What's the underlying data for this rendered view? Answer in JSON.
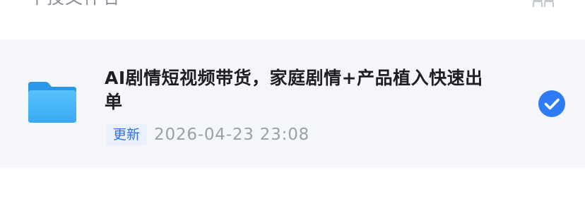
{
  "header": {
    "title": "千技文件名",
    "grid_icon": "grid-view-icon"
  },
  "file_item": {
    "icon": "folder-icon",
    "name": "AI剧情短视频带货，家庭剧情+产品植入快速出单",
    "badge_label": "更新",
    "updated_at": "2026-04-23 23:08",
    "selected": true,
    "check_icon": "check-circle-icon"
  },
  "colors": {
    "item_background": "#f5f6fa",
    "accent": "#2f7bf5",
    "folder": "#3fb2f5",
    "badge_text": "#2f6fe4",
    "badge_background": "#eaf1fd"
  }
}
